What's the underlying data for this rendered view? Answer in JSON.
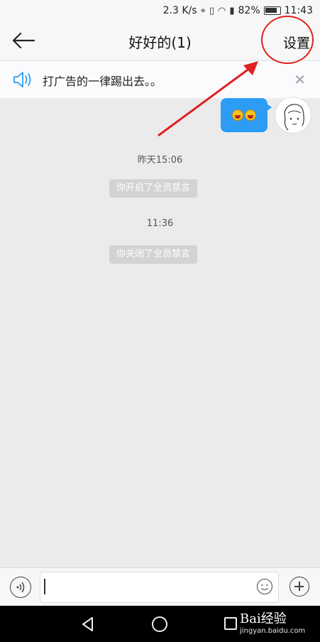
{
  "status_bar": {
    "net_speed": "2.3 K/s",
    "battery": "82%",
    "time": "11:43",
    "icons": [
      "location-icon",
      "vibrate-icon",
      "wifi-icon",
      "signal-4g-icon",
      "battery-icon"
    ]
  },
  "header": {
    "title": "好好的(1)",
    "settings_label": "设置"
  },
  "notice": {
    "text": "打广告的一律踢出去。。"
  },
  "messages": {
    "timestamp_1": "昨天15:06",
    "system_1": "你开启了全员禁言",
    "timestamp_2": "11:36",
    "system_2": "你关闭了全员禁言"
  },
  "input": {
    "value": "",
    "placeholder": ""
  },
  "watermark": {
    "brand": "Bai经验",
    "site": "jingyan.baidu.com"
  },
  "colors": {
    "accent": "#2d9cf4",
    "annotation": "#e02020",
    "background": "#ebebeb"
  }
}
